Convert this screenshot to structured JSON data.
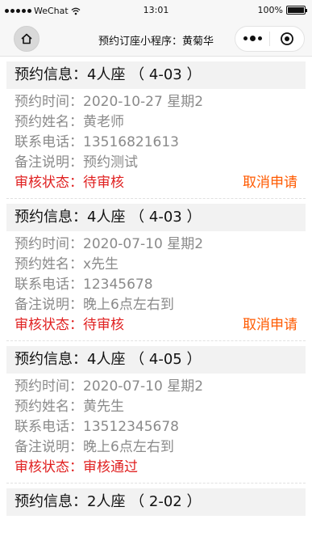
{
  "status_bar": {
    "carrier": "WeChat",
    "time": "13:01",
    "battery": "100%"
  },
  "nav": {
    "title": "预约订座小程序：黄菊华"
  },
  "labels": {
    "time": "预约时间：",
    "name": "预约姓名：",
    "phone": "联系电话：",
    "note": "备注说明：",
    "status": "审核状态："
  },
  "bookings": [
    {
      "title": "预约信息：4人座 （ 4-03 ）",
      "time": "2020-10-27 星期2",
      "name": "黄老师",
      "phone": "13516821613",
      "note": "预约测试",
      "status": "待审核",
      "cancel_label": "取消申请"
    },
    {
      "title": "预约信息：4人座 （ 4-03 ）",
      "time": "2020-07-10 星期2",
      "name": "x先生",
      "phone": "12345678",
      "note": "晚上6点左右到",
      "status": "待审核",
      "cancel_label": "取消申请"
    },
    {
      "title": "预约信息：4人座 （ 4-05 ）",
      "time": "2020-07-10 星期2",
      "name": "黄先生",
      "phone": "13512345678",
      "note": "晚上6点左右到",
      "status": "审核通过",
      "cancel_label": ""
    },
    {
      "title": "预约信息：2人座 （ 2-02 ）"
    }
  ],
  "colors": {
    "status_red": "#e02020",
    "cancel_orange": "#ff5a00",
    "nav_bg": "#f7f7f7"
  },
  "icons": [
    "home-icon",
    "more-icon",
    "close-target-icon",
    "signal-icon",
    "wifi-icon",
    "battery-icon"
  ]
}
